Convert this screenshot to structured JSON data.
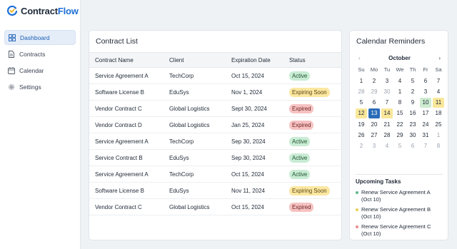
{
  "app": {
    "name_prefix": "Contract",
    "name_accent": "Flow"
  },
  "sidebar": {
    "items": [
      {
        "label": "Dashboard",
        "icon": "grid-icon",
        "active": true
      },
      {
        "label": "Contracts",
        "icon": "document-icon",
        "active": false
      },
      {
        "label": "Calendar",
        "icon": "calendar-icon",
        "active": false
      },
      {
        "label": "Settings",
        "icon": "gear-icon",
        "active": false
      }
    ]
  },
  "contracts": {
    "title": "Contract List",
    "columns": [
      "Contract Name",
      "Client",
      "Expiration Date",
      "Status"
    ],
    "rows": [
      {
        "name": "Service Agreement A",
        "client": "TechCorp",
        "date": "Oct 15, 2024",
        "status": "Active"
      },
      {
        "name": "Software License B",
        "client": "EduSys",
        "date": "Nov 1, 2024",
        "status": "Expiring Soon"
      },
      {
        "name": "Vendor Contract C",
        "client": "Global Logistics",
        "date": "Sept 30, 2024",
        "status": "Expired"
      },
      {
        "name": "Vendor Contract D",
        "client": "Global Logistics",
        "date": "Jan 25, 2024",
        "status": "Expired"
      },
      {
        "name": "Service Agreement A",
        "client": "TechCorp",
        "date": "Sep 30, 2024",
        "status": "Active"
      },
      {
        "name": "Service Contract B",
        "client": "EduSys",
        "date": "Sep 30, 2024",
        "status": "Active"
      },
      {
        "name": "Service Agreement A",
        "client": "TechCorp",
        "date": "Oct 15, 2024",
        "status": "Active"
      },
      {
        "name": "Software License B",
        "client": "EduSys",
        "date": "Nov 11, 2024",
        "status": "Expiring Soon"
      },
      {
        "name": "Vendor Contract C",
        "client": "Global Logistics",
        "date": "Oct 15, 2024",
        "status": "Expired"
      }
    ]
  },
  "calendar": {
    "title": "Calendar Reminders",
    "month": "October",
    "prev": "‹",
    "next": "›",
    "weekdays": [
      "Su",
      "Mo",
      "Tu",
      "We",
      "Th",
      "Fr",
      "Sa"
    ],
    "weeks": [
      [
        {
          "d": "1",
          "m": false,
          "h": ""
        },
        {
          "d": "2",
          "m": false,
          "h": ""
        },
        {
          "d": "3",
          "m": false,
          "h": ""
        },
        {
          "d": "4",
          "m": false,
          "h": ""
        },
        {
          "d": "5",
          "m": false,
          "h": ""
        },
        {
          "d": "6",
          "m": false,
          "h": ""
        },
        {
          "d": "7",
          "m": false,
          "h": ""
        }
      ],
      [
        {
          "d": "28",
          "m": true,
          "h": ""
        },
        {
          "d": "29",
          "m": true,
          "h": ""
        },
        {
          "d": "30",
          "m": true,
          "h": ""
        },
        {
          "d": "1",
          "m": false,
          "h": ""
        },
        {
          "d": "2",
          "m": false,
          "h": ""
        },
        {
          "d": "3",
          "m": false,
          "h": ""
        },
        {
          "d": "4",
          "m": false,
          "h": ""
        }
      ],
      [
        {
          "d": "5",
          "m": false,
          "h": ""
        },
        {
          "d": "6",
          "m": false,
          "h": ""
        },
        {
          "d": "7",
          "m": false,
          "h": ""
        },
        {
          "d": "8",
          "m": false,
          "h": ""
        },
        {
          "d": "9",
          "m": false,
          "h": ""
        },
        {
          "d": "10",
          "m": false,
          "h": "green"
        },
        {
          "d": "11",
          "m": false,
          "h": "yellow"
        }
      ],
      [
        {
          "d": "12",
          "m": false,
          "h": "yellow"
        },
        {
          "d": "13",
          "m": false,
          "h": "blue"
        },
        {
          "d": "14",
          "m": false,
          "h": "yellow"
        },
        {
          "d": "15",
          "m": false,
          "h": ""
        },
        {
          "d": "16",
          "m": false,
          "h": ""
        },
        {
          "d": "17",
          "m": false,
          "h": ""
        },
        {
          "d": "18",
          "m": false,
          "h": ""
        }
      ],
      [
        {
          "d": "19",
          "m": false,
          "h": ""
        },
        {
          "d": "20",
          "m": false,
          "h": ""
        },
        {
          "d": "21",
          "m": false,
          "h": ""
        },
        {
          "d": "22",
          "m": false,
          "h": ""
        },
        {
          "d": "23",
          "m": false,
          "h": ""
        },
        {
          "d": "24",
          "m": false,
          "h": ""
        },
        {
          "d": "25",
          "m": false,
          "h": ""
        }
      ],
      [
        {
          "d": "26",
          "m": false,
          "h": ""
        },
        {
          "d": "27",
          "m": false,
          "h": ""
        },
        {
          "d": "28",
          "m": false,
          "h": ""
        },
        {
          "d": "29",
          "m": false,
          "h": ""
        },
        {
          "d": "30",
          "m": false,
          "h": ""
        },
        {
          "d": "31",
          "m": false,
          "h": ""
        },
        {
          "d": "1",
          "m": true,
          "h": ""
        }
      ],
      [
        {
          "d": "2",
          "m": true,
          "h": ""
        },
        {
          "d": "3",
          "m": true,
          "h": ""
        },
        {
          "d": "4",
          "m": true,
          "h": ""
        },
        {
          "d": "5",
          "m": true,
          "h": ""
        },
        {
          "d": "6",
          "m": true,
          "h": ""
        },
        {
          "d": "7",
          "m": true,
          "h": ""
        },
        {
          "d": "8",
          "m": true,
          "h": ""
        }
      ]
    ],
    "tasks_title": "Upcoming Tasks",
    "tasks": [
      {
        "line1": "Renew Service Agreement A",
        "line2": "(Oct 10)",
        "color": "#5fb98a"
      },
      {
        "line1": "Renew Service Agreement B",
        "line2": "(Oct 10)",
        "color": "#e9cf5a"
      },
      {
        "line1": "Renew Service Agreement C",
        "line2": "(Oct 10)",
        "color": "#e88f8f"
      }
    ]
  },
  "colors": {
    "accent": "#1d6fd6",
    "active": "#c9ecd4",
    "expiring": "#fbe7a1",
    "expired": "#f6c2c2"
  }
}
